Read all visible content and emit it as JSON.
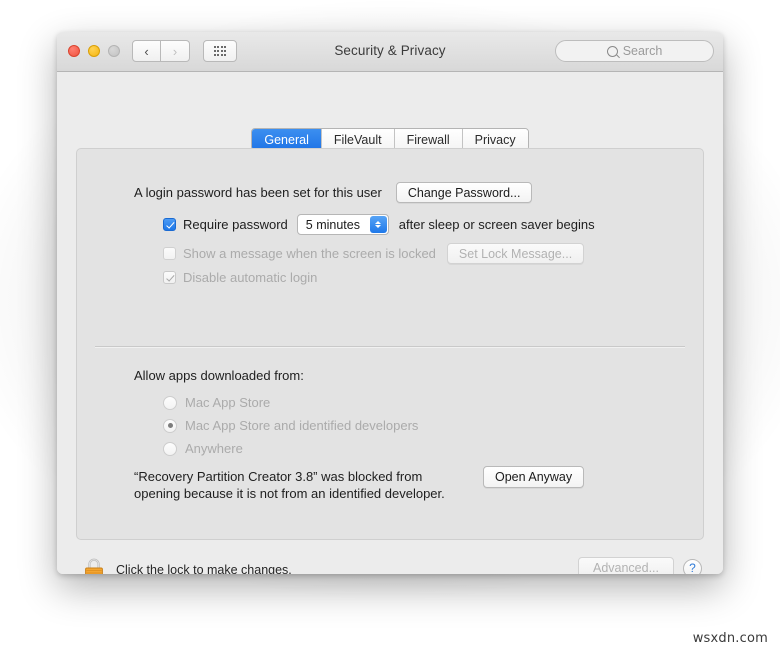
{
  "window": {
    "title": "Security & Privacy",
    "traffic_lights": [
      "close",
      "minimize",
      "zoom"
    ],
    "nav": {
      "back_icon": "chevron-left-icon",
      "forward_icon": "chevron-right-icon",
      "show_all_icon": "grid-icon"
    }
  },
  "search": {
    "placeholder": "Search",
    "icon": "search-icon",
    "value": ""
  },
  "tabs": [
    {
      "label": "General",
      "active": true
    },
    {
      "label": "FileVault",
      "active": false
    },
    {
      "label": "Firewall",
      "active": false
    },
    {
      "label": "Privacy",
      "active": false
    }
  ],
  "general": {
    "login_password_text": "A login password has been set for this user",
    "change_password_label": "Change Password...",
    "require_password": {
      "label": "Require password",
      "checked": true,
      "delay_value": "5 minutes",
      "suffix": "after sleep or screen saver begins"
    },
    "show_message": {
      "label": "Show a message when the screen is locked",
      "checked": false,
      "button_label": "Set Lock Message...",
      "enabled": false
    },
    "disable_auto_login": {
      "label": "Disable automatic login",
      "checked": true,
      "enabled": false
    }
  },
  "gatekeeper": {
    "heading": "Allow apps downloaded from:",
    "options": [
      {
        "label": "Mac App Store",
        "selected": false
      },
      {
        "label": "Mac App Store and identified developers",
        "selected": true
      },
      {
        "label": "Anywhere",
        "selected": false
      }
    ],
    "blocked_message": "“Recovery Partition Creator 3.8” was blocked from opening because it is not from an identified developer.",
    "open_anyway_label": "Open Anyway"
  },
  "footer": {
    "lock_icon": "closed-lock-icon",
    "lock_text": "Click the lock to make changes.",
    "advanced_label": "Advanced...",
    "advanced_enabled": false,
    "help_label": "?"
  },
  "watermark": "wsxdn.com",
  "colors": {
    "accent_blue": "#1f74e6",
    "window_bg": "#ececec",
    "panel_bg": "#e3e3e3",
    "lock_gold": "#f0a323"
  }
}
